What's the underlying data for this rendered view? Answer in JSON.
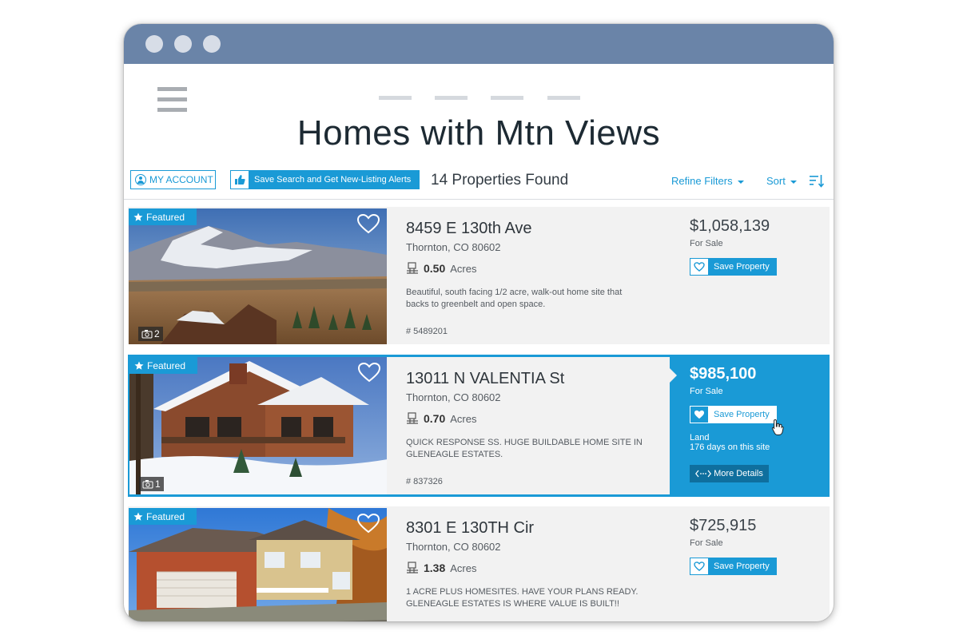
{
  "page": {
    "title": "Homes with Mtn Views"
  },
  "toolbar": {
    "account_label": "MY ACCOUNT",
    "alerts_label": "Save Search and Get New-Listing Alerts",
    "found_text": "14 Properties Found",
    "refine_label": "Refine Filters",
    "sort_label": "Sort"
  },
  "icons": {
    "account": "user-icon",
    "alerts": "thumbs-up-icon",
    "sort": "sort-descending-icon",
    "heart": "heart-icon",
    "camera": "camera-icon",
    "acres": "lot-size-icon",
    "more": "expand-arrows-icon"
  },
  "colors": {
    "accent": "#1a9ad6",
    "titlebar": "#6a84a8",
    "card_bg": "#f2f2f2"
  },
  "listings": [
    {
      "featured_label": "Featured",
      "photo_count": "2",
      "address": "8459 E 130th Ave",
      "city": "Thornton, CO 80602",
      "acres_value": "0.50",
      "acres_unit": "Acres",
      "description": "Beautiful, south facing 1/2 acre, walk-out home site that backs to greenbelt and open space.",
      "mls": "# 5489201",
      "price": "$1,058,139",
      "status": "For Sale",
      "save_label": "Save Property"
    },
    {
      "featured_label": "Featured",
      "photo_count": "1",
      "address": "13011 N VALENTIA St",
      "city": "Thornton, CO 80602",
      "acres_value": "0.70",
      "acres_unit": "Acres",
      "description": "QUICK RESPONSE SS. HUGE BUILDABLE HOME SITE IN GLENEAGLE ESTATES.",
      "mls": "# 837326",
      "price": "$985,100",
      "status": "For Sale",
      "save_label": "Save Property",
      "type": "Land",
      "days_on_site": "176 days on this site",
      "more_label": "More Details"
    },
    {
      "featured_label": "Featured",
      "address": "8301 E 130TH Cir",
      "city": "Thornton, CO 80602",
      "acres_value": "1.38",
      "acres_unit": "Acres",
      "description": "1 ACRE PLUS HOMESITES. HAVE YOUR PLANS READY. GLENEAGLE ESTATES IS WHERE VALUE IS BUILT!!",
      "price": "$725,915",
      "status": "For Sale",
      "save_label": "Save Property"
    }
  ]
}
